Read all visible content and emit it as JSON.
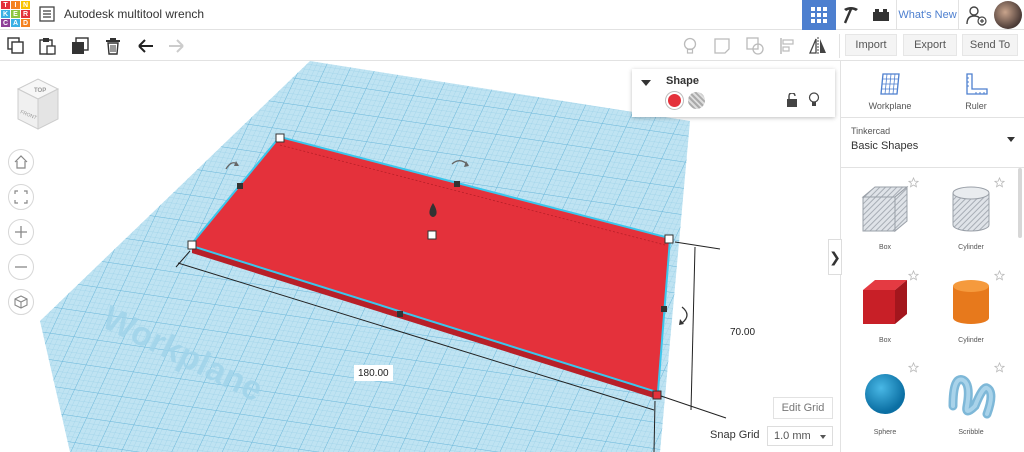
{
  "app": {
    "logo_letters": [
      "T",
      "I",
      "N",
      "K",
      "E",
      "R",
      "C",
      "A",
      "D"
    ],
    "logo_colors": [
      "#e4313b",
      "#f58220",
      "#f8c300",
      "#3bb0e4",
      "#8cc63f",
      "#e4313b",
      "#8e3f97",
      "#3bb0e4",
      "#f58220"
    ],
    "document_title": "Autodesk multitool wrench",
    "whats_new": "What's New",
    "accent": "#4d7fcf"
  },
  "toolbar": {
    "import": "Import",
    "export": "Export",
    "send_to": "Send To"
  },
  "viewcube": {
    "top": "TOP",
    "front": "FRONT"
  },
  "workplane_label": "Workplane",
  "shape_panel": {
    "title": "Shape",
    "solid_color": "#e4313b"
  },
  "dimensions": {
    "length": "180.00",
    "width": "70.00"
  },
  "edit_grid": "Edit Grid",
  "snap_grid": {
    "label": "Snap Grid",
    "value": "1.0 mm"
  },
  "right_panel": {
    "workplane": "Workplane",
    "ruler": "Ruler",
    "library_source": "Tinkercad",
    "library_name": "Basic Shapes",
    "shapes": [
      {
        "name": "Box",
        "style": "hole"
      },
      {
        "name": "Cylinder",
        "style": "hole"
      },
      {
        "name": "Box",
        "style": "red"
      },
      {
        "name": "Cylinder",
        "style": "orange"
      },
      {
        "name": "Sphere",
        "style": "blue"
      },
      {
        "name": "Scribble",
        "style": "scribble"
      }
    ]
  }
}
